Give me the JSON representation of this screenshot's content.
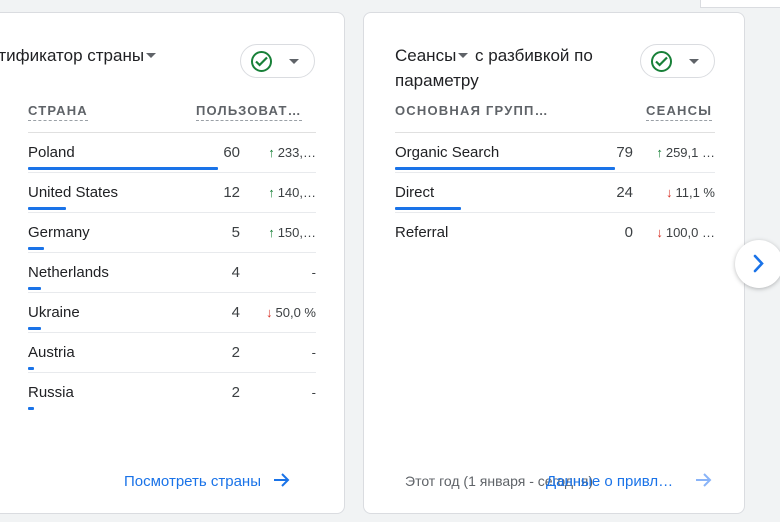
{
  "countries_card": {
    "title": "нтификатор страны",
    "col1_header": "СТРАНА",
    "col2_header": "ПОЛЬЗОВАТ…",
    "rows": [
      {
        "label": "Poland",
        "value": "60",
        "change": "233,…",
        "dir": "up",
        "share": 1.0
      },
      {
        "label": "United States",
        "value": "12",
        "change": "140,…",
        "dir": "up",
        "share": 0.2
      },
      {
        "label": "Germany",
        "value": "5",
        "change": "150,…",
        "dir": "up",
        "share": 0.083
      },
      {
        "label": "Netherlands",
        "value": "4",
        "change": "-",
        "dir": "none",
        "share": 0.067
      },
      {
        "label": "Ukraine",
        "value": "4",
        "change": "50,0 %",
        "dir": "down",
        "share": 0.067
      },
      {
        "label": "Austria",
        "value": "2",
        "change": "-",
        "dir": "none",
        "share": 0.033
      },
      {
        "label": "Russia",
        "value": "2",
        "change": "-",
        "dir": "none",
        "share": 0.033
      }
    ],
    "link_label": "Посмотреть страны"
  },
  "sessions_card": {
    "title": "Сеансы",
    "title_rest": "с разбивкой по параметру",
    "col1_header": "ОСНОВНАЯ ГРУПП…",
    "col2_header": "СЕАНСЫ",
    "rows": [
      {
        "label": "Organic Search",
        "value": "79",
        "change": "259,1 …",
        "dir": "up",
        "share": 1.0
      },
      {
        "label": "Direct",
        "value": "24",
        "change": "11,1 %",
        "dir": "down",
        "share": 0.3
      },
      {
        "label": "Referral",
        "value": "0",
        "change": "100,0 …",
        "dir": "down",
        "share": 0.0
      }
    ],
    "footnote": "Этот год (1 января - сегодня)",
    "link_label": "Данные о привл…"
  },
  "colors": {
    "accent": "#1a73e8",
    "up": "#188038",
    "down": "#d93025"
  },
  "icons": {
    "status": "check-circle-icon",
    "next": "chevron-right-icon",
    "link": "arrow-right-icon"
  }
}
